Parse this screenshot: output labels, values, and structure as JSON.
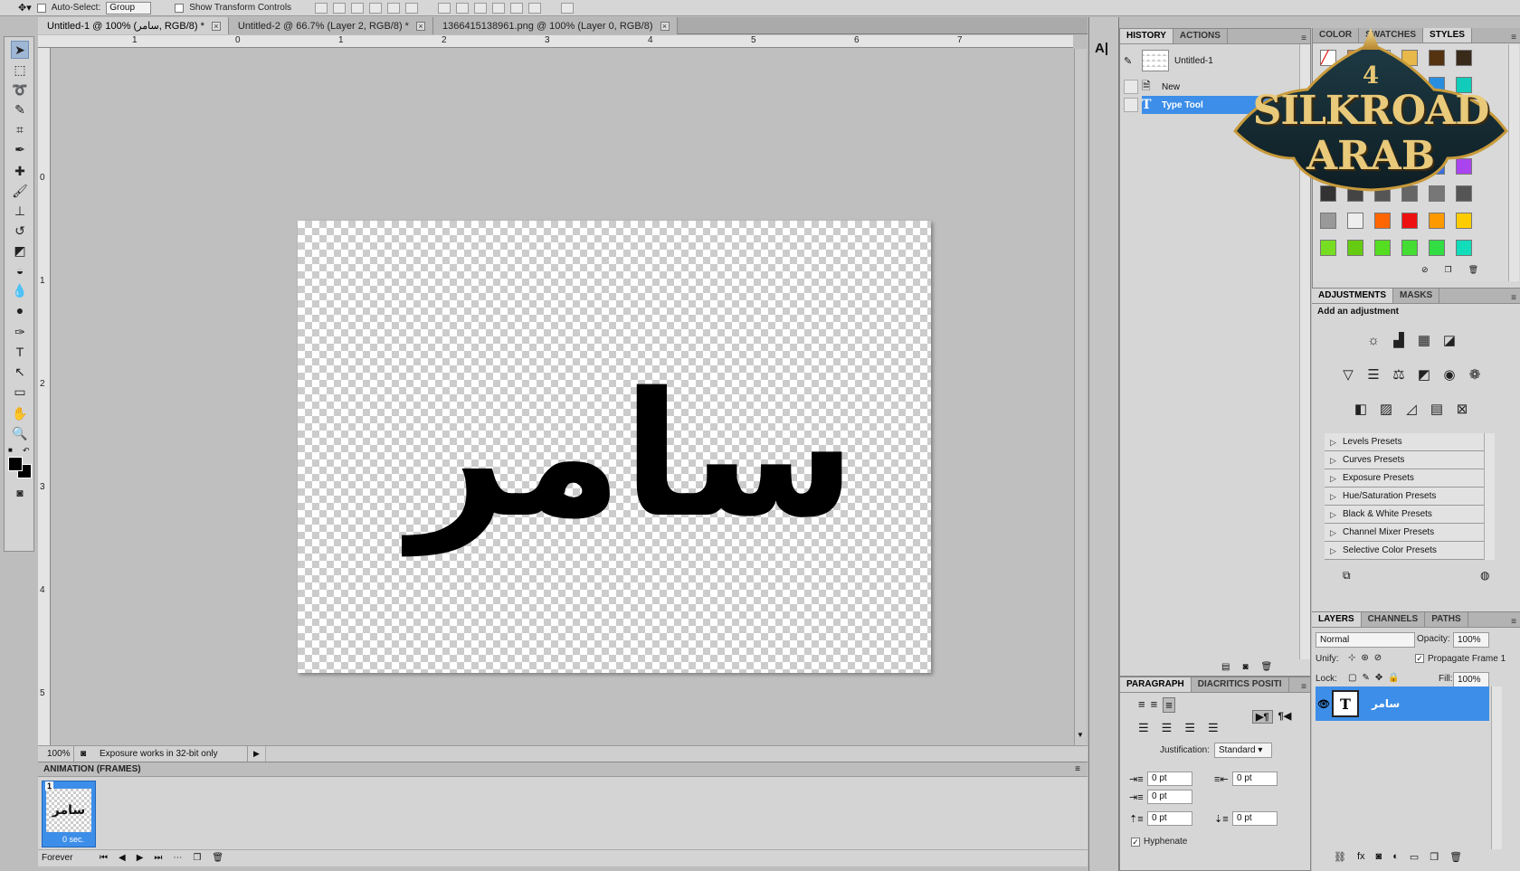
{
  "options_bar": {
    "auto_select_label": "Auto-Select:",
    "auto_select_value": "Group",
    "transform_label": "Show Transform Controls"
  },
  "document_tabs": [
    {
      "title": "Untitled-1 @ 100% (سامر, RGB/8) *",
      "active": true
    },
    {
      "title": "Untitled-2 @ 66.7% (Layer 2, RGB/8) *",
      "active": false
    },
    {
      "title": "1366415138961.png @ 100% (Layer 0, RGB/8)",
      "active": false
    }
  ],
  "ruler": {
    "top_marks": [
      "1",
      "0",
      "1",
      "2",
      "3",
      "4",
      "5",
      "6",
      "7"
    ],
    "left_marks": [
      "0",
      "1",
      "2",
      "3",
      "4",
      "5"
    ]
  },
  "canvas": {
    "text": "سامر",
    "text_color": "#000000"
  },
  "status_bar": {
    "zoom": "100%",
    "message": "Exposure works in 32-bit only"
  },
  "animation": {
    "title": "ANIMATION (FRAMES)",
    "frame_number": "1",
    "frame_delay": "0 sec.",
    "loop": "Forever"
  },
  "history": {
    "tabs": [
      "HISTORY",
      "ACTIONS"
    ],
    "snapshot": "Untitled-1",
    "items": [
      "New",
      "Type Tool"
    ],
    "selected_index": 1
  },
  "paragraph": {
    "tabs": [
      "PARAGRAPH",
      "DIACRITICS POSITI"
    ],
    "justification_label": "Justification:",
    "justification_value": "Standard",
    "indent_values": [
      "0 pt",
      "0 pt",
      "0 pt",
      "0 pt",
      "0 pt"
    ],
    "hyphenate_label": "Hyphenate"
  },
  "swatches": {
    "tabs": [
      "COLOR",
      "SWATCHES",
      "STYLES"
    ]
  },
  "adjustments": {
    "tabs": [
      "ADJUSTMENTS",
      "MASKS"
    ],
    "heading": "Add an adjustment",
    "presets": [
      "Levels Presets",
      "Curves Presets",
      "Exposure Presets",
      "Hue/Saturation Presets",
      "Black & White Presets",
      "Channel Mixer Presets",
      "Selective Color Presets"
    ]
  },
  "layers": {
    "tabs": [
      "LAYERS",
      "CHANNELS",
      "PATHS"
    ],
    "blend_mode": "Normal",
    "opacity_label": "Opacity:",
    "opacity_value": "100%",
    "unify_label": "Unify:",
    "propagate_label": "Propagate Frame 1",
    "lock_label": "Lock:",
    "fill_label": "Fill:",
    "fill_value": "100%",
    "layer_name": "سامر",
    "layer_thumb": "T"
  },
  "watermark": {
    "line1": "4",
    "line2": "SILKROAD",
    "line3": "ARAB"
  },
  "colors": {
    "selection_blue": "#3d8ee8",
    "panel_gray": "#d6d6d6"
  }
}
